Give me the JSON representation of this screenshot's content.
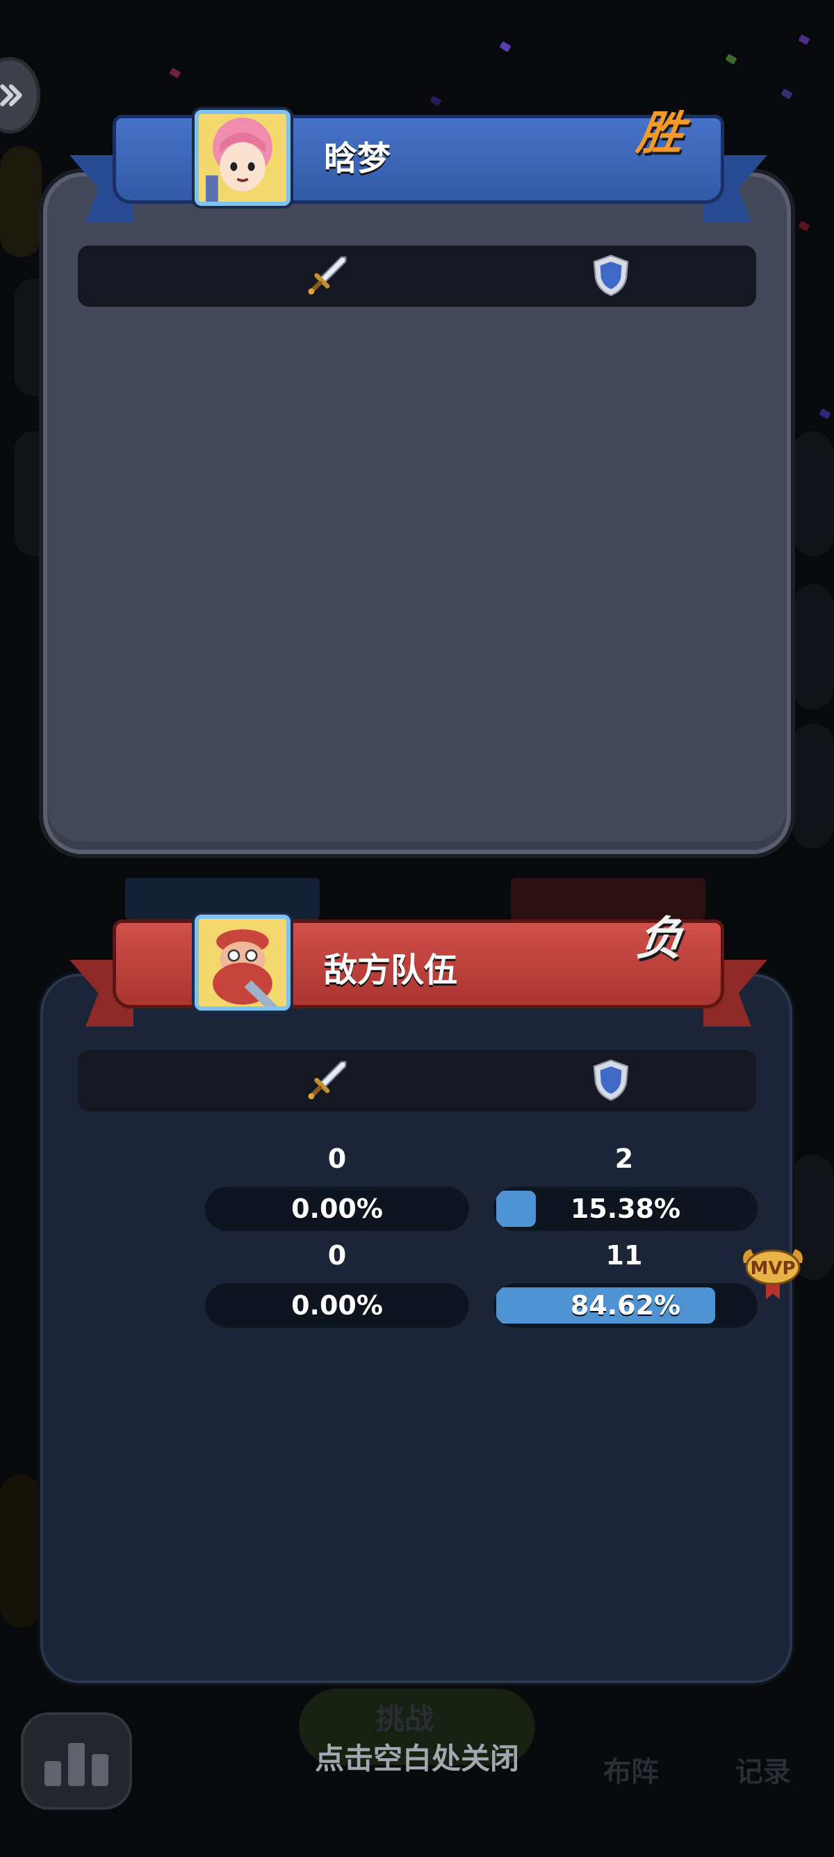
{
  "background": {
    "nav": {
      "challenge": "挑战",
      "formation": "布阵",
      "record": "记录"
    },
    "close_hint": "点击空白处关闭"
  },
  "teams": [
    {
      "name": "晗梦",
      "result": "胜",
      "color": "#3a63b8",
      "avatar_icon": "pink-haired-girl-avatar",
      "header_icons": [
        "sword-icon",
        "shield-icon"
      ],
      "rows": []
    },
    {
      "name": "敌方队伍",
      "result": "负",
      "color": "#c14541",
      "avatar_icon": "red-bearded-dwarf-avatar",
      "header_icons": [
        "sword-icon",
        "shield-icon"
      ],
      "rows": [
        {
          "damage": "0",
          "damage_pct": "0.00%",
          "damage_fraction": 0.0,
          "tank": "2",
          "tank_pct": "15.38%",
          "tank_fraction": 0.1538,
          "mvp": false
        },
        {
          "damage": "0",
          "damage_pct": "0.00%",
          "damage_fraction": 0.0,
          "tank": "11",
          "tank_pct": "84.62%",
          "tank_fraction": 0.8462,
          "mvp": true
        }
      ]
    }
  ],
  "mvp_badge": "MVP",
  "colors": {
    "win": "#f39a2a",
    "lose": "#f2f2f2",
    "bar_fill": "#4f93d2"
  }
}
